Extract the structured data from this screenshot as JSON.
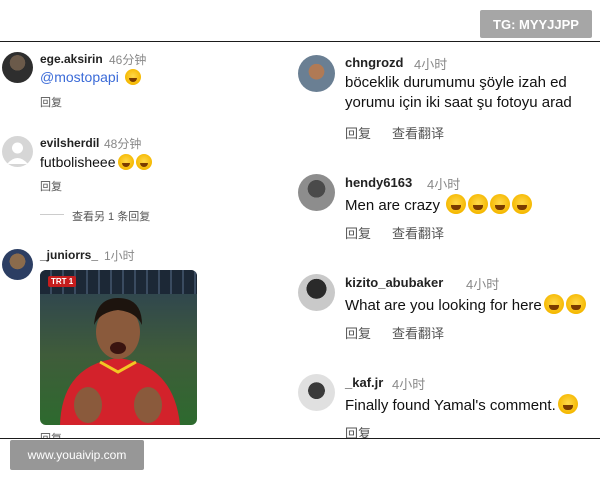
{
  "watermarks": {
    "top": "TG: MYYJJPP",
    "bottom": "www.youaivip.com"
  },
  "left_comments": [
    {
      "username": "ege.aksirin",
      "time": "46分钟",
      "text": "@mostopapi",
      "reply": "回复"
    },
    {
      "username": "evilsherdil",
      "time": "48分钟",
      "text": "futbolisheee",
      "reply": "回复",
      "view_more": "查看另 1 条回复"
    },
    {
      "username": "_juniorrs_",
      "time": "1小时",
      "media_logo": "TRT 1",
      "reply": "回复"
    }
  ],
  "right_comments": [
    {
      "username": "chngrozd",
      "time": "4小时",
      "text_line1": "böceklik durumumu şöyle izah ed",
      "text_line2": "yorumu için iki saat şu fotoyu arad",
      "reply": "回复",
      "translate": "查看翻译"
    },
    {
      "username": "hendy6163",
      "time": "4小时",
      "text": "Men are crazy",
      "reply": "回复",
      "translate": "查看翻译"
    },
    {
      "username": "kizito_abubaker",
      "time": "4小时",
      "text": "What are you looking for here",
      "reply": "回复",
      "translate": "查看翻译"
    },
    {
      "username": "_kaf.jr",
      "time": "4小时",
      "text": "Finally found Yamal's comment.",
      "reply": "回复"
    }
  ],
  "icons": {
    "laugh_emoji": "face-with-tears-of-joy",
    "avatar_placeholder": "default-person-icon"
  },
  "colors": {
    "link": "#3b6bd8",
    "secondary_text": "#888888",
    "watermark_bg": "#969696"
  }
}
